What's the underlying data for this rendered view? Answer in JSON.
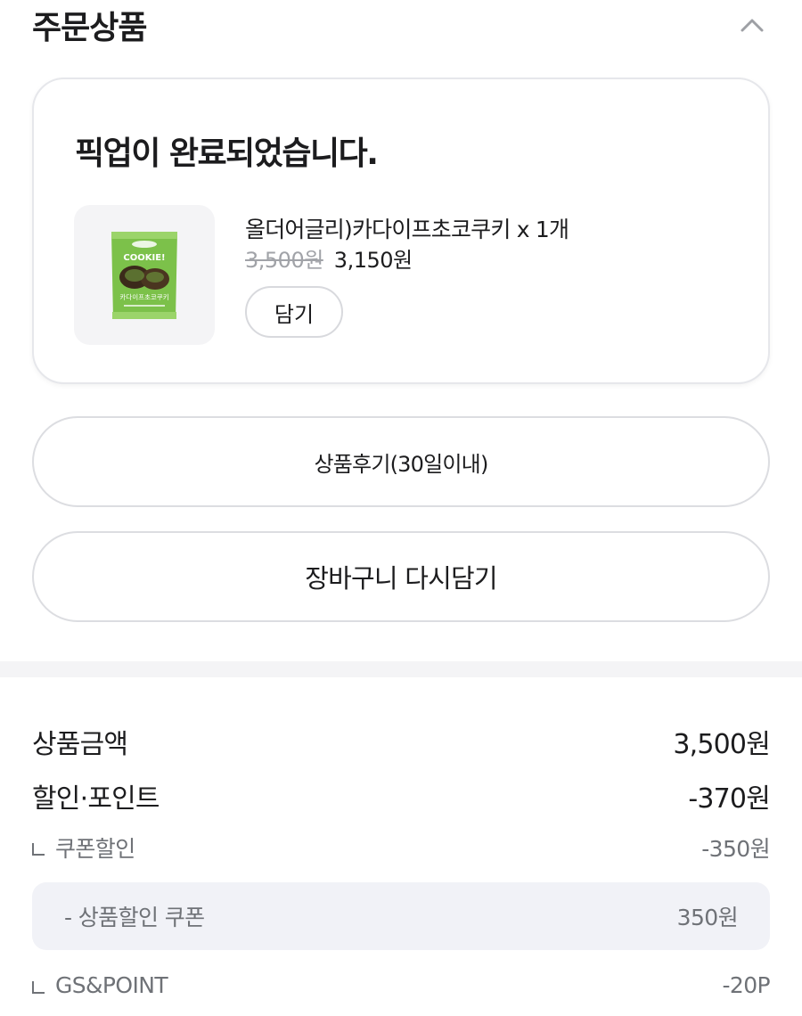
{
  "section": {
    "title": "주문상품",
    "collapse_icon": "chevron-up-icon"
  },
  "order": {
    "status": "픽업이 완료되었습니다.",
    "product": {
      "name": "올더어글리)카다이프초코쿠키 x 1개",
      "original_price": "3,500원",
      "sale_price": "3,150원",
      "image_label": "COOKIE!",
      "image_sub_label": "카다이프초코쿠키",
      "add_button": "담기"
    }
  },
  "buttons": {
    "review": "상품후기(30일이내)",
    "recart": "장바구니 다시담기"
  },
  "summary": {
    "product_amount_label": "상품금액",
    "product_amount_value": "3,500원",
    "discount_label": "할인·포인트",
    "discount_value": "-370원",
    "coupon_label": "쿠폰할인",
    "coupon_value": "-350원",
    "coupon_detail_label": "- 상품할인 쿠폰",
    "coupon_detail_value": "350원",
    "point_label": "GS&POINT",
    "point_value": "-20P"
  },
  "colors": {
    "text": "#1c1c1e",
    "muted": "#6f7277",
    "strike": "#a1a3a8",
    "border": "#dcdde1",
    "band": "#f4f4f6",
    "coupon_bg": "#f1f2f7",
    "package_green": "#7cc14a"
  }
}
